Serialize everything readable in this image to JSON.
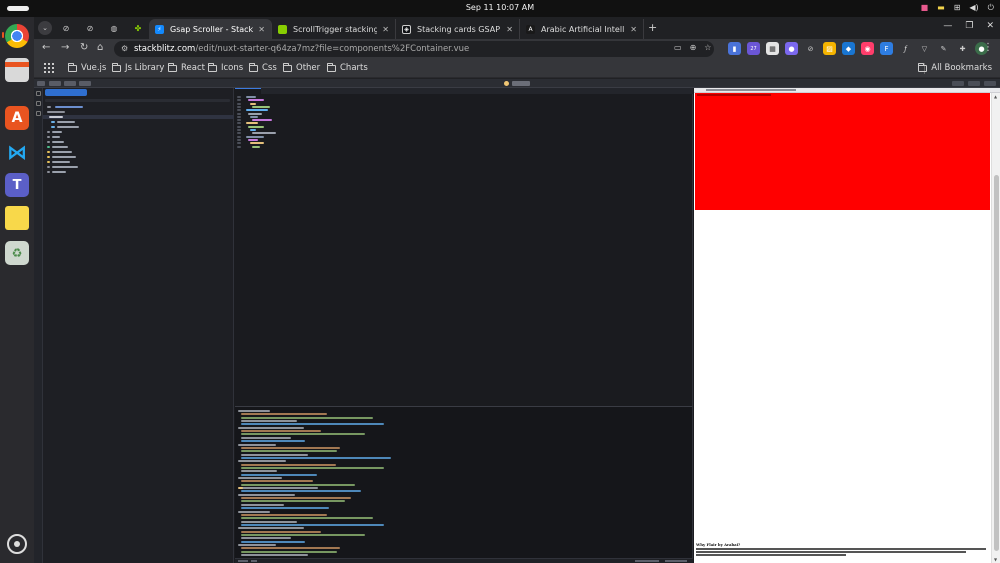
{
  "topbar": {
    "clock": "Sep 11  10:07 AM"
  },
  "tabs": [
    {
      "title": "Gsap Scroller - StackBlitz",
      "active": true,
      "favicon_color": "#1389fd"
    },
    {
      "title": "ScrollTrigger stacking ca",
      "active": false,
      "favicon_color": "#88ce02"
    },
    {
      "title": "Stacking cards GSAP Scr",
      "active": false,
      "favicon_color": "#0e1014"
    },
    {
      "title": "Arabic Artificial Intellige",
      "active": false,
      "favicon_color": "#191919"
    }
  ],
  "omnibox": {
    "host": "stackblitz.com",
    "path": "/edit/nuxt-starter-q64za7mz?file=components%2FContainer.vue"
  },
  "bookmarks": [
    {
      "label": "Vue.js",
      "icon": "vue-icon"
    },
    {
      "label": "Js Library",
      "icon": "folder-icon"
    },
    {
      "label": "React",
      "icon": "folder-icon"
    },
    {
      "label": "Icons",
      "icon": "folder-icon"
    },
    {
      "label": "Css",
      "icon": "folder-icon"
    },
    {
      "label": "Other",
      "icon": "folder-icon"
    },
    {
      "label": "Charts",
      "icon": "folder-icon"
    }
  ],
  "all_bookmarks": "All Bookmarks",
  "extension_badge": "27",
  "preview": {
    "heading": "Why Flair by Arabai?"
  },
  "colors": {
    "accent": "#e95420",
    "stackblitz_blue": "#1389fd",
    "preview_red": "#ff0000"
  }
}
